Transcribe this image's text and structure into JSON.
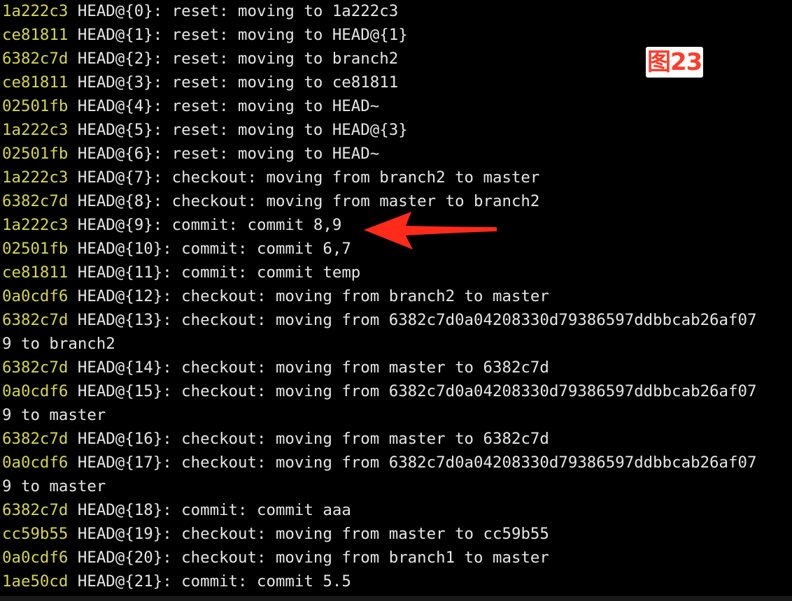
{
  "terminal": {
    "lines": [
      {
        "hash": "1a222c3",
        "ref": "HEAD@{0}",
        "msg": ": reset: moving to 1a222c3"
      },
      {
        "hash": "ce81811",
        "ref": "HEAD@{1}",
        "msg": ": reset: moving to HEAD@{1}"
      },
      {
        "hash": "6382c7d",
        "ref": "HEAD@{2}",
        "msg": ": reset: moving to branch2"
      },
      {
        "hash": "ce81811",
        "ref": "HEAD@{3}",
        "msg": ": reset: moving to ce81811"
      },
      {
        "hash": "02501fb",
        "ref": "HEAD@{4}",
        "msg": ": reset: moving to HEAD~"
      },
      {
        "hash": "1a222c3",
        "ref": "HEAD@{5}",
        "msg": ": reset: moving to HEAD@{3}"
      },
      {
        "hash": "02501fb",
        "ref": "HEAD@{6}",
        "msg": ": reset: moving to HEAD~"
      },
      {
        "hash": "1a222c3",
        "ref": "HEAD@{7}",
        "msg": ": checkout: moving from branch2 to master"
      },
      {
        "hash": "6382c7d",
        "ref": "HEAD@{8}",
        "msg": ": checkout: moving from master to branch2"
      },
      {
        "hash": "1a222c3",
        "ref": "HEAD@{9}",
        "msg": ": commit: commit 8,9"
      },
      {
        "hash": "02501fb",
        "ref": "HEAD@{10}",
        "msg": ": commit: commit 6,7"
      },
      {
        "hash": "ce81811",
        "ref": "HEAD@{11}",
        "msg": ": commit: commit temp"
      },
      {
        "hash": "0a0cdf6",
        "ref": "HEAD@{12}",
        "msg": ": checkout: moving from branch2 to master"
      },
      {
        "hash": "6382c7d",
        "ref": "HEAD@{13}",
        "msg": ": checkout: moving from 6382c7d0a04208330d79386597ddbbcab26af07"
      },
      {
        "hash": "",
        "ref": "",
        "msg": "9 to branch2"
      },
      {
        "hash": "6382c7d",
        "ref": "HEAD@{14}",
        "msg": ": checkout: moving from master to 6382c7d"
      },
      {
        "hash": "0a0cdf6",
        "ref": "HEAD@{15}",
        "msg": ": checkout: moving from 6382c7d0a04208330d79386597ddbbcab26af07"
      },
      {
        "hash": "",
        "ref": "",
        "msg": "9 to master"
      },
      {
        "hash": "6382c7d",
        "ref": "HEAD@{16}",
        "msg": ": checkout: moving from master to 6382c7d"
      },
      {
        "hash": "0a0cdf6",
        "ref": "HEAD@{17}",
        "msg": ": checkout: moving from 6382c7d0a04208330d79386597ddbbcab26af07"
      },
      {
        "hash": "",
        "ref": "",
        "msg": "9 to master"
      },
      {
        "hash": "6382c7d",
        "ref": "HEAD@{18}",
        "msg": ": commit: commit aaa"
      },
      {
        "hash": "cc59b55",
        "ref": "HEAD@{19}",
        "msg": ": checkout: moving from master to cc59b55"
      },
      {
        "hash": "0a0cdf6",
        "ref": "HEAD@{20}",
        "msg": ": checkout: moving from branch1 to master"
      },
      {
        "hash": "1ae50cd",
        "ref": "HEAD@{21}",
        "msg": ": commit: commit 5.5"
      }
    ]
  },
  "annotation": {
    "figure_label": "图23",
    "arrow_icon": "red-arrow-left-icon",
    "arrow_color": "#ff2a1a"
  },
  "colors": {
    "background": "#000000",
    "hash": "#d6d64a",
    "text": "#e6e6e6"
  }
}
